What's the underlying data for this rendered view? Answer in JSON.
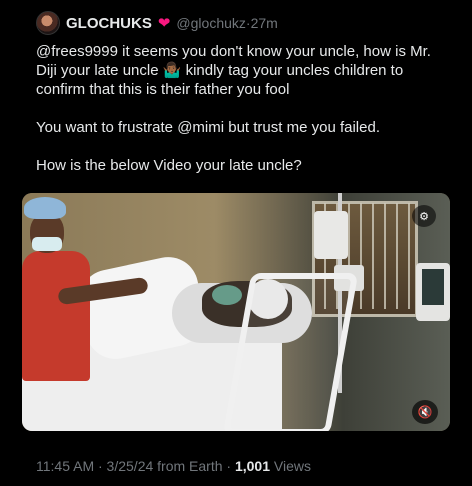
{
  "header": {
    "display_name": "GLOCHUKS",
    "badge_icon": "heart-icon",
    "handle": "@glochukz",
    "separator": "·",
    "time_ago": "27m"
  },
  "tweet": {
    "line1": "@frees9999 it seems you don't know your uncle, how is Mr. Diji your late uncle 🤷🏾‍♂️ kindly tag your uncles children to confirm that this is their father you fool",
    "line2": "You want to frustrate @mimi but trust me you failed.",
    "line3": "How is the below Video your late uncle?"
  },
  "media": {
    "gif_icon": "gif-settings-icon",
    "mute_icon": "speaker-mute-icon",
    "gif_glyph": "⚙",
    "mute_glyph": "🔇"
  },
  "footer": {
    "timestamp": "11:45 AM · 3/25/24 from Earth · ",
    "views_count": "1,001",
    "views_label": " Views"
  },
  "colors": {
    "background": "#000000",
    "text": "#e7e9ea",
    "muted": "#71767b",
    "heart": "#f91880"
  }
}
